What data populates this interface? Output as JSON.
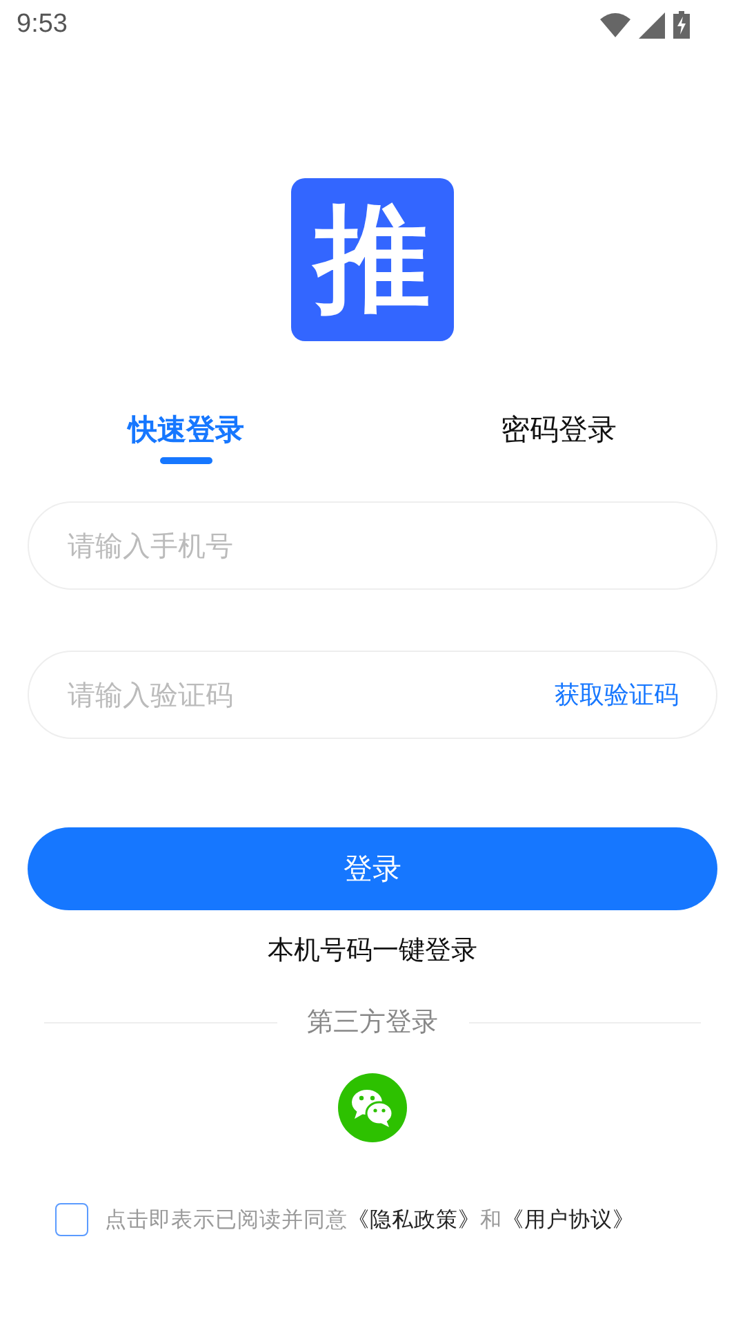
{
  "status_bar": {
    "time": "9:53"
  },
  "logo": {
    "text": "推"
  },
  "tabs": [
    {
      "label": "快速登录",
      "selected": true
    },
    {
      "label": "密码登录",
      "selected": false
    }
  ],
  "fields": [
    {
      "placeholder": "请输入手机号"
    },
    {
      "placeholder": "请输入验证码",
      "action": "获取验证码"
    }
  ],
  "login_button": "登录",
  "one_click_login": "本机号码一键登录",
  "third_party": {
    "label": "第三方登录"
  },
  "agreement": {
    "checked": false,
    "parts": [
      {
        "kind": "text",
        "text": "点击即表示已阅读并同意"
      },
      {
        "kind": "link",
        "text": "《隐私政策》"
      },
      {
        "kind": "text",
        "text": "和"
      },
      {
        "kind": "link",
        "text": "《用户协议》"
      }
    ]
  }
}
